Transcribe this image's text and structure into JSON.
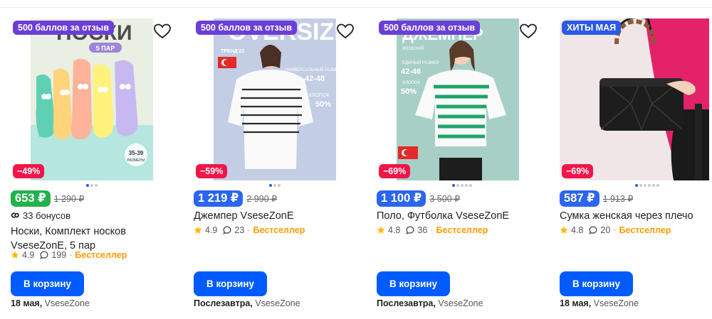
{
  "products": [
    {
      "promo": "500 баллов за отзыв",
      "promo_color": "#6b3fd6",
      "image_text": [
        "НОСКИ",
        "5 ПАР",
        "35-39",
        "РАЗМЕРЫ"
      ],
      "discount": "−49%",
      "price": "653 ₽",
      "price_color": "#22b14c",
      "old_price": "1 290 ₽",
      "bonus": "33 бонусов",
      "title": "Носки, Комплект носков VseseZonE, 5 пар",
      "rating": "4.9",
      "reviews": "199",
      "badge": "Бестселлер",
      "cart": "В корзину",
      "delivery_date": "18 мая,",
      "seller": "VseseZone",
      "carousel_images": 3,
      "carousel_active": 1
    },
    {
      "promo": "500 баллов за отзыв",
      "promo_color": "#6b3fd6",
      "image_text": [
        "OVERSIZE",
        "ТРЕНД'23",
        "УНИВЕРСАЛЬНЫЙ РАЗМЕР",
        "42-48",
        "ХЛОПОК",
        "50%"
      ],
      "discount": "−59%",
      "price": "1 219 ₽",
      "price_color": "#2c66ee",
      "old_price": "2 990 ₽",
      "title": "Джемпер VseseZonE",
      "rating": "4.9",
      "reviews": "23",
      "badge": "Бестселлер",
      "cart": "В корзину",
      "delivery_date": "Послезавтра,",
      "seller": "VseseZone",
      "carousel_images": 3,
      "carousel_active": 1
    },
    {
      "promo": "500 баллов за отзыв",
      "promo_color": "#6b3fd6",
      "image_text": [
        "ДЖЕМПЕР",
        "ЖЕНСКИЙ",
        "ЕДИНЫЙ РАЗМЕР",
        "42-46",
        "ХЛОПОК",
        "50%"
      ],
      "discount": "−69%",
      "price": "1 100 ₽",
      "price_color": "#2c66ee",
      "old_price": "3 500 ₽",
      "title": "Поло, Футболка VseseZonE",
      "rating": "4.8",
      "reviews": "36",
      "badge": "Бестселлер",
      "cart": "В корзину",
      "delivery_date": "Послезавтра,",
      "seller": "VseseZone",
      "carousel_images": 5,
      "carousel_active": 1
    },
    {
      "promo": "ХИТЫ МАЯ",
      "promo_color": "#2b59e8",
      "discount": "−69%",
      "price": "587 ₽",
      "price_color": "#2c66ee",
      "old_price": "1 913 ₽",
      "title": "Сумка женская через плечо",
      "rating": "4.8",
      "reviews": "20",
      "badge": "Бестселлер",
      "cart": "В корзину",
      "delivery_date": "18 мая,",
      "seller": "VseseZone",
      "carousel_images": 6,
      "carousel_active": 1
    }
  ],
  "icons": {
    "favorite": "heart-icon",
    "rating": "star-icon",
    "reviews": "comment-bubble-icon",
    "bonus": "bonus-link-icon"
  },
  "colors": {
    "cart_button": "#005bff",
    "discount": "#f0164a",
    "bestseller": "#ff9900",
    "star": "#ffb800"
  }
}
